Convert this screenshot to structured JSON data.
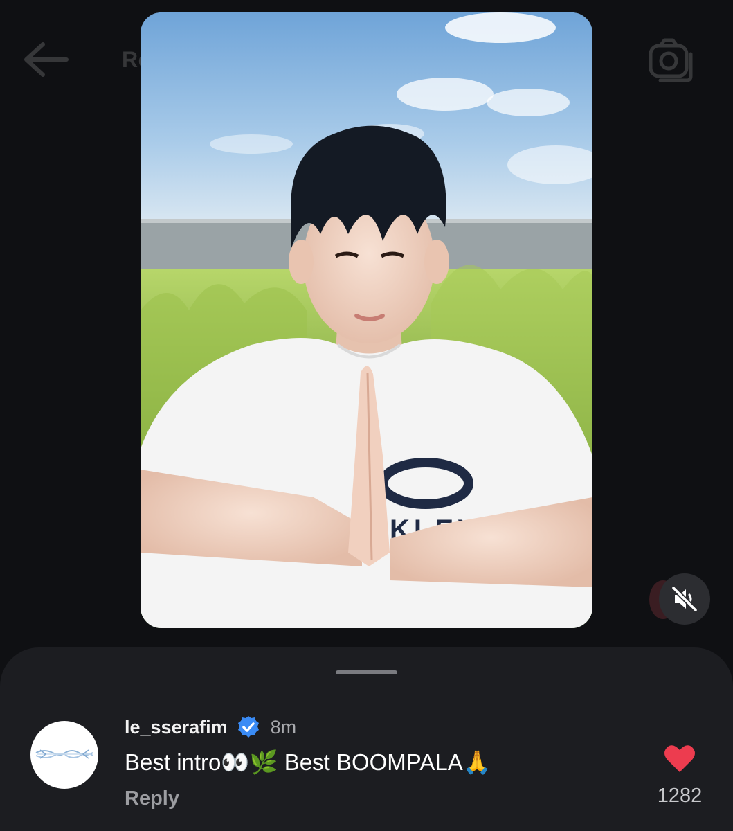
{
  "header": {
    "title": "Reels",
    "back_icon": "arrow-left-icon",
    "camera_icon": "camera-icon"
  },
  "reel": {
    "media_label": "OAKLEY",
    "mute_icon": "speaker-muted-icon"
  },
  "comment": {
    "username": "le_sserafim",
    "verified_icon": "verified-badge-icon",
    "time": "8m",
    "text": "Best intro👀🌿 Best BOOMPALA🙏",
    "reply_label": "Reply",
    "like_icon": "heart-filled-icon",
    "like_count": "1282"
  },
  "colors": {
    "background": "#0f1013",
    "sheet": "#1c1d21",
    "heart": "#ed3c4f",
    "verified": "#3a8bf5"
  }
}
